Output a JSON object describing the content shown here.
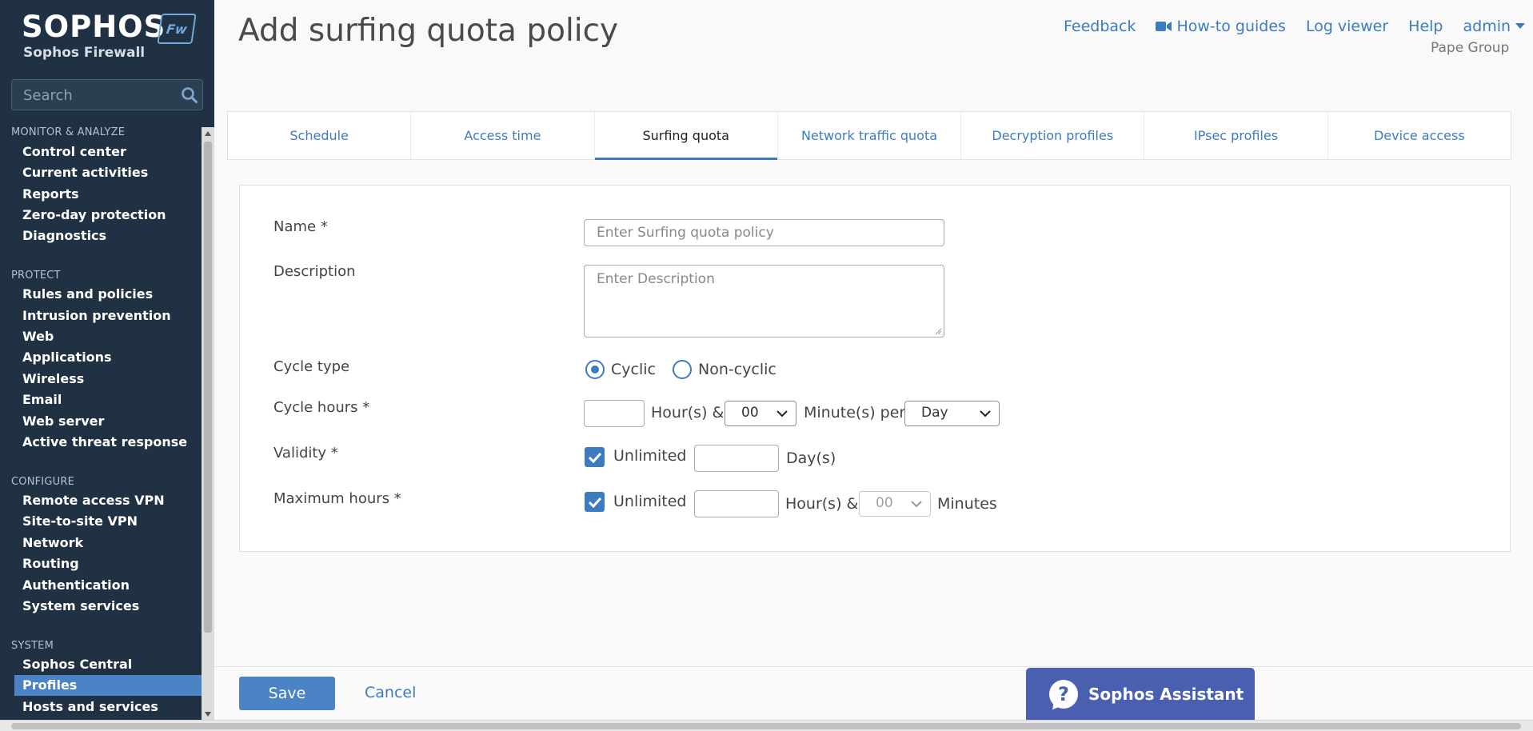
{
  "sidebar": {
    "brand": "SOPHOS",
    "product": "Sophos Firewall",
    "badge": "Fw",
    "search_placeholder": "Search",
    "sections": [
      {
        "title": "MONITOR & ANALYZE",
        "items": [
          "Control center",
          "Current activities",
          "Reports",
          "Zero-day protection",
          "Diagnostics"
        ]
      },
      {
        "title": "PROTECT",
        "items": [
          "Rules and policies",
          "Intrusion prevention",
          "Web",
          "Applications",
          "Wireless",
          "Email",
          "Web server",
          "Active threat response"
        ]
      },
      {
        "title": "CONFIGURE",
        "items": [
          "Remote access VPN",
          "Site-to-site VPN",
          "Network",
          "Routing",
          "Authentication",
          "System services"
        ]
      },
      {
        "title": "SYSTEM",
        "items": [
          "Sophos Central",
          "Profiles",
          "Hosts and services"
        ]
      }
    ],
    "active_item": "Profiles"
  },
  "header": {
    "title": "Add surfing quota policy",
    "links": {
      "feedback": "Feedback",
      "howto": "How-to guides",
      "logviewer": "Log viewer",
      "help": "Help",
      "user": "admin"
    },
    "org": "Pape Group"
  },
  "tabs": [
    "Schedule",
    "Access time",
    "Surfing quota",
    "Network traffic quota",
    "Decryption profiles",
    "IPsec profiles",
    "Device access"
  ],
  "active_tab": "Surfing quota",
  "form": {
    "name": {
      "label": "Name *",
      "placeholder": "Enter Surfing quota policy",
      "value": ""
    },
    "description": {
      "label": "Description",
      "placeholder": "Enter Description",
      "value": ""
    },
    "cycle_type": {
      "label": "Cycle type",
      "options": [
        "Cyclic",
        "Non-cyclic"
      ],
      "selected": "Cyclic"
    },
    "cycle_hours": {
      "label": "Cycle hours *",
      "hours_value": "",
      "hours_suffix": "Hour(s) &",
      "minutes_value": "00",
      "minutes_suffix": "Minute(s) per",
      "period_value": "Day"
    },
    "validity": {
      "label": "Validity *",
      "unlimited_label": "Unlimited",
      "unlimited": true,
      "days_value": "",
      "days_suffix": "Day(s)"
    },
    "maximum_hours": {
      "label": "Maximum hours *",
      "unlimited_label": "Unlimited",
      "unlimited": true,
      "hours_value": "",
      "hours_suffix": "Hour(s) &",
      "minutes_value": "00",
      "minutes_suffix": "Minutes"
    }
  },
  "footer": {
    "save": "Save",
    "cancel": "Cancel",
    "assistant": "Sophos Assistant",
    "assistant_icon_glyph": "?"
  },
  "colors": {
    "sidebar_bg": "#1f3142",
    "accent": "#3d7bc1",
    "active_nav": "#4a84c4",
    "assistant": "#4a5fb0"
  }
}
